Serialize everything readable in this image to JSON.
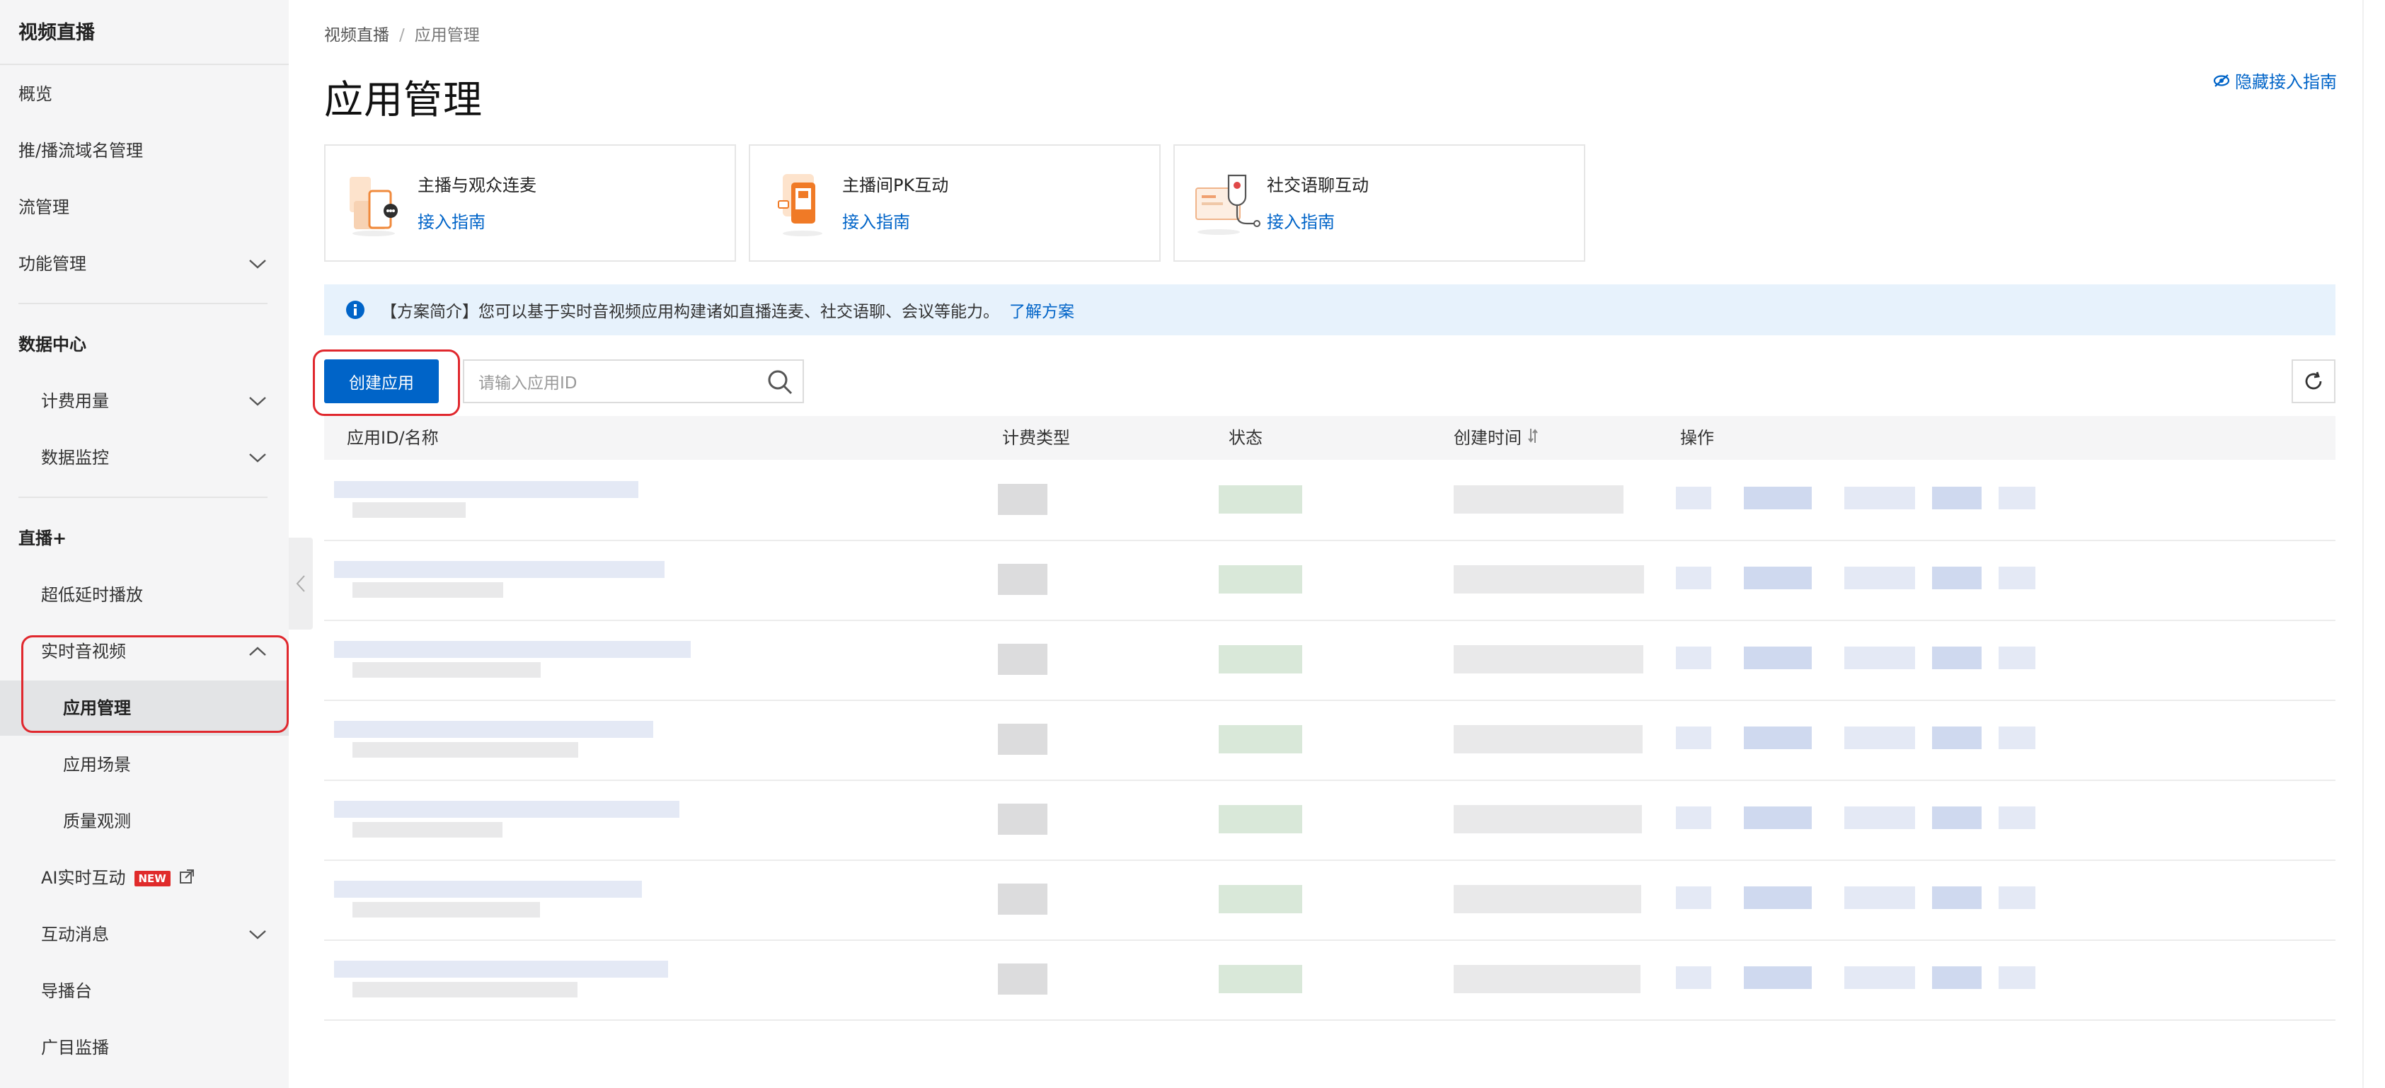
{
  "sidebar": {
    "title": "视频直播",
    "items": [
      {
        "label": "概览"
      },
      {
        "label": "推/播流域名管理"
      },
      {
        "label": "流管理"
      },
      {
        "label": "功能管理"
      },
      {
        "label": "数据中心"
      },
      {
        "label": "计费用量"
      },
      {
        "label": "数据监控"
      },
      {
        "label": "直播+"
      },
      {
        "label": "超低延时播放"
      },
      {
        "label": "实时音视频"
      },
      {
        "label": "应用管理"
      },
      {
        "label": "应用场景"
      },
      {
        "label": "质量观测"
      },
      {
        "label": "AI实时互动",
        "badge": "NEW"
      },
      {
        "label": "互动消息"
      },
      {
        "label": "导播台"
      },
      {
        "label": "广目监播"
      }
    ]
  },
  "breadcrumb": {
    "root": "视频直播",
    "separator": "/",
    "current": "应用管理"
  },
  "page": {
    "title": "应用管理",
    "guide_toggle": "隐藏接入指南"
  },
  "cards": [
    {
      "title": "主播与观众连麦",
      "link": "接入指南"
    },
    {
      "title": "主播间PK互动",
      "link": "接入指南"
    },
    {
      "title": "社交语聊互动",
      "link": "接入指南"
    }
  ],
  "info": {
    "text": "【方案简介】您可以基于实时音视频应用构建诸如直播连麦、社交语聊、会议等能力。",
    "link": "了解方案"
  },
  "toolbar": {
    "create_label": "创建应用",
    "search_placeholder": "请输入应用ID"
  },
  "table": {
    "columns": [
      "应用ID/名称",
      "计费类型",
      "状态",
      "创建时间",
      "操作"
    ],
    "row_count": 7
  },
  "colors": {
    "accent": "#0064c8",
    "highlight": "#e0282e",
    "info_bg": "#e7f2fc"
  }
}
